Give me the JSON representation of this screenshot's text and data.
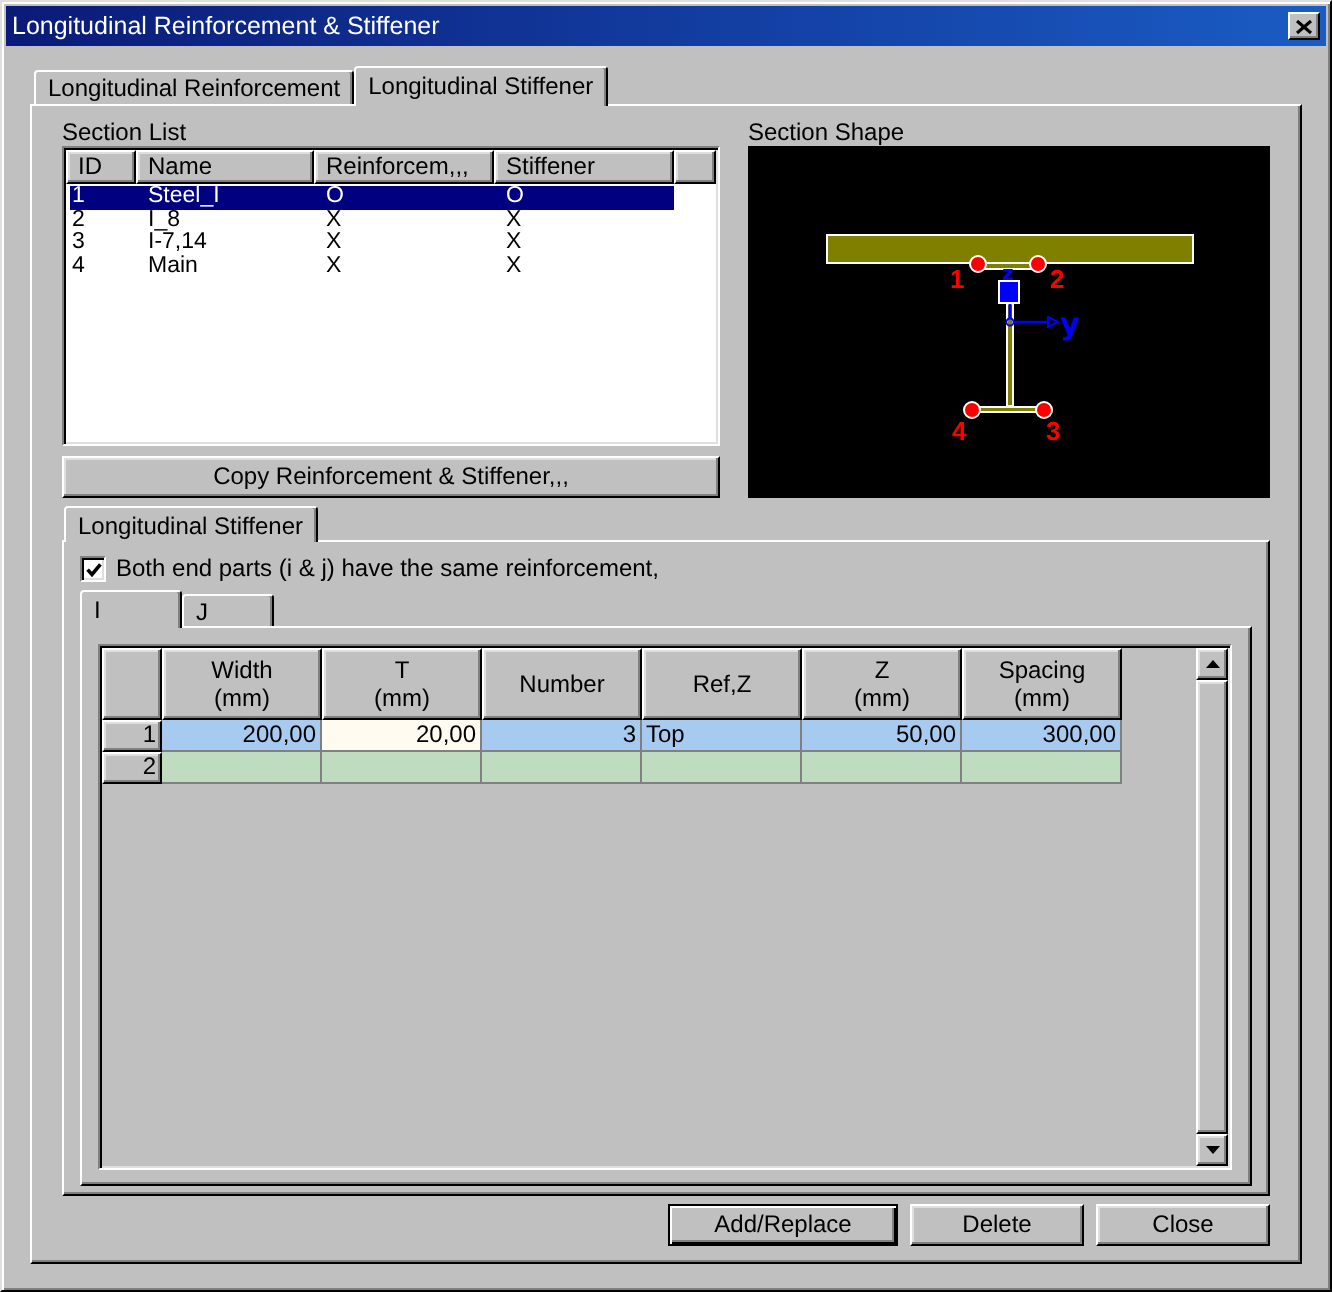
{
  "window": {
    "title": "Longitudinal Reinforcement & Stiffener"
  },
  "tabs": [
    {
      "label": "Longitudinal Reinforcement",
      "selected": false
    },
    {
      "label": "Longitudinal Stiffener",
      "selected": true
    }
  ],
  "section_list": {
    "label": "Section List",
    "columns": [
      "ID",
      "Name",
      "Reinforcem,,,",
      "Stiffener"
    ],
    "rows": [
      {
        "cells": [
          "1",
          "Steel_I",
          "O",
          "O"
        ],
        "selected": true
      },
      {
        "cells": [
          "2",
          "I_8",
          "X",
          "X"
        ],
        "selected": false
      },
      {
        "cells": [
          "3",
          "I-7,14",
          "X",
          "X"
        ],
        "selected": false
      },
      {
        "cells": [
          "4",
          "Main",
          "X",
          "X"
        ],
        "selected": false
      }
    ]
  },
  "copy_button": {
    "label": "Copy Reinforcement & Stiffener,,,"
  },
  "section_shape": {
    "label": "Section Shape",
    "points": [
      "1",
      "2",
      "4",
      "3"
    ],
    "axes": [
      "z",
      "y"
    ]
  },
  "stiffener": {
    "tabs": [
      {
        "label": "Longitudinal Stiffener",
        "selected": true
      }
    ],
    "same_reinforcement": {
      "label": "Both end parts (i & j) have the same reinforcement,",
      "checked": true
    },
    "end_tabs": [
      {
        "label": "I",
        "selected": true
      },
      {
        "label": "J",
        "selected": false
      }
    ],
    "grid": {
      "columns": [
        {
          "title": "Width",
          "unit": "(mm)",
          "kind": "number"
        },
        {
          "title": "T",
          "unit": "(mm)",
          "kind": "number"
        },
        {
          "title": "Number",
          "kind": "number"
        },
        {
          "title": "Ref,Z",
          "kind": "text"
        },
        {
          "title": "Z",
          "unit": "(mm)",
          "kind": "number"
        },
        {
          "title": "Spacing",
          "unit": "(mm)",
          "kind": "number"
        }
      ],
      "rows": [
        {
          "number": "1",
          "selected": true,
          "cells": [
            {
              "text": "200,00",
              "focused": false
            },
            {
              "text": "20,00",
              "focused": true
            },
            {
              "text": "3",
              "focused": false
            },
            {
              "text": "Top",
              "focused": false
            },
            {
              "text": "50,00",
              "focused": false
            },
            {
              "text": "300,00",
              "focused": false
            }
          ]
        },
        {
          "number": "2",
          "selected": false
        }
      ]
    }
  },
  "buttons": [
    {
      "label": "Add/Replace",
      "default": true
    },
    {
      "label": "Delete",
      "default": false
    },
    {
      "label": "Close",
      "default": false
    }
  ]
}
